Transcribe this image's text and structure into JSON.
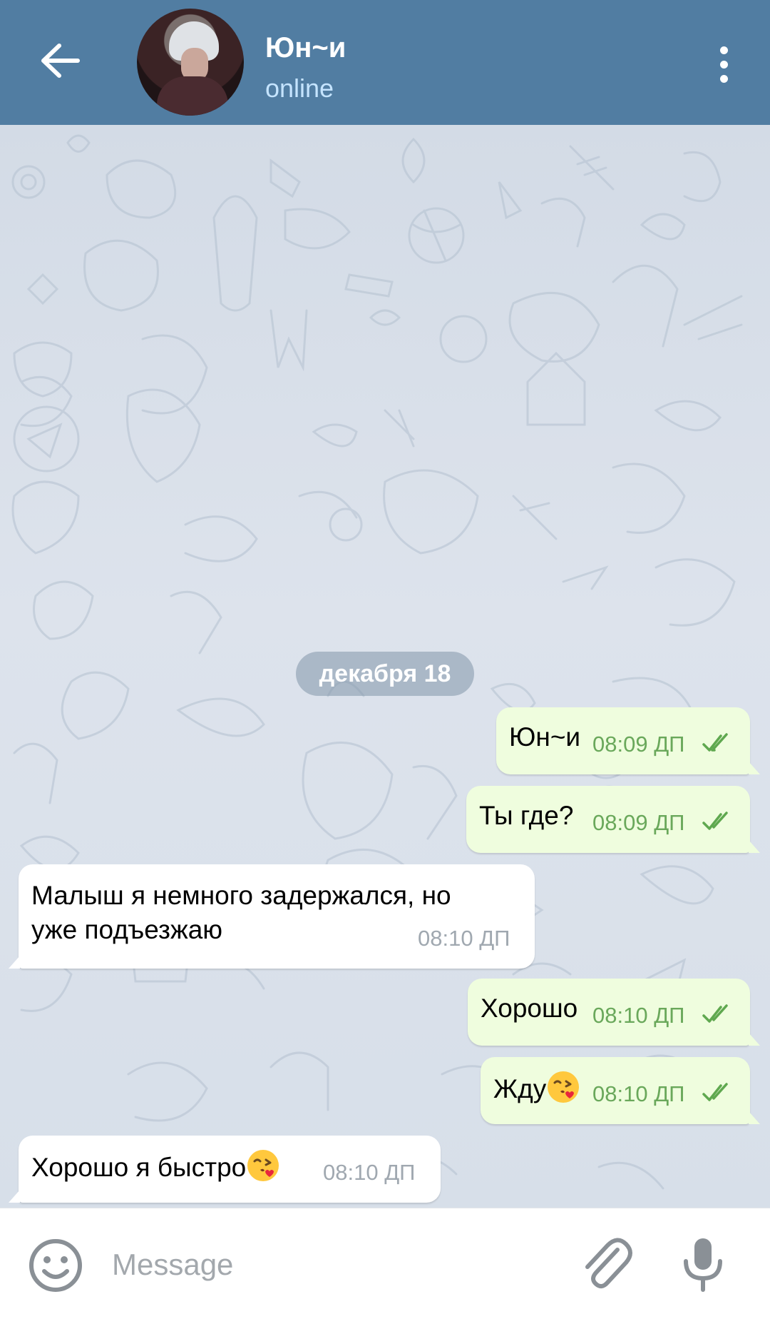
{
  "header": {
    "back_icon": "arrow-left-icon",
    "contact_name": "Юн~и",
    "status": "online",
    "menu_icon": "more-vertical-icon"
  },
  "chat": {
    "date_separator": "декабря 18",
    "messages": [
      {
        "direction": "out",
        "text": "Юн~и",
        "time": "08:09 ДП",
        "status": "read"
      },
      {
        "direction": "out",
        "text": "Ты где?",
        "time": "08:09 ДП",
        "status": "read"
      },
      {
        "direction": "in",
        "text_line1": "Малыш я немного задержался, но",
        "text_line2": "уже подъезжаю",
        "time": "08:10 ДП"
      },
      {
        "direction": "out",
        "text": "Хорошо",
        "time": "08:10 ДП",
        "status": "read"
      },
      {
        "direction": "out",
        "text": "Жду",
        "emoji": "face-throwing-kiss",
        "time": "08:10 ДП",
        "status": "read"
      },
      {
        "direction": "in",
        "text": "Хорошо я быстро",
        "emoji": "face-throwing-kiss",
        "time": "08:10 ДП"
      }
    ]
  },
  "input_bar": {
    "placeholder": "Message",
    "emoji_icon": "smiley-icon",
    "attach_icon": "paperclip-icon",
    "mic_icon": "microphone-icon"
  },
  "colors": {
    "header_bg": "#517da2",
    "status_text": "#c5e4ff",
    "outgoing_bubble": "#effdde",
    "incoming_bubble": "#ffffff",
    "outgoing_time": "#6aa85b",
    "incoming_time": "#a0a8b0"
  }
}
